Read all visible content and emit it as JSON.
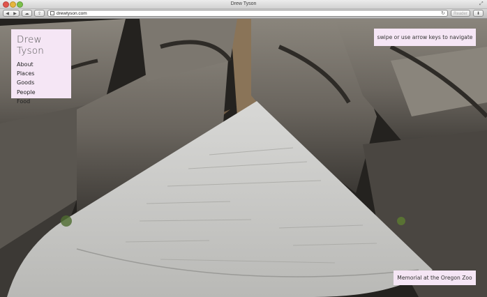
{
  "window": {
    "title": "Drew Tyson"
  },
  "toolbar": {
    "back_glyph": "◀",
    "forward_glyph": "▶",
    "url": "drewtyson.com",
    "reader_label": "Reader",
    "reload_glyph": "↻"
  },
  "site": {
    "title": "Drew Tyson",
    "nav": [
      "About",
      "Places",
      "Goods",
      "People",
      "Food"
    ],
    "hint": "swipe or use arrow keys to navigate",
    "caption": "Memorial at the Oregon Zoo"
  },
  "icons": {
    "close": "close-icon",
    "minimize": "minimize-icon",
    "maximize": "maximize-icon",
    "fullscreen": "fullscreen-icon",
    "icloud": "cloud-icon",
    "share": "share-icon",
    "favicon": "favicon-icon",
    "downloads": "downloads-icon"
  },
  "colors": {
    "panel": "#f5e6f5",
    "stone": "#6e6962",
    "slab": "#c9c9c6"
  }
}
